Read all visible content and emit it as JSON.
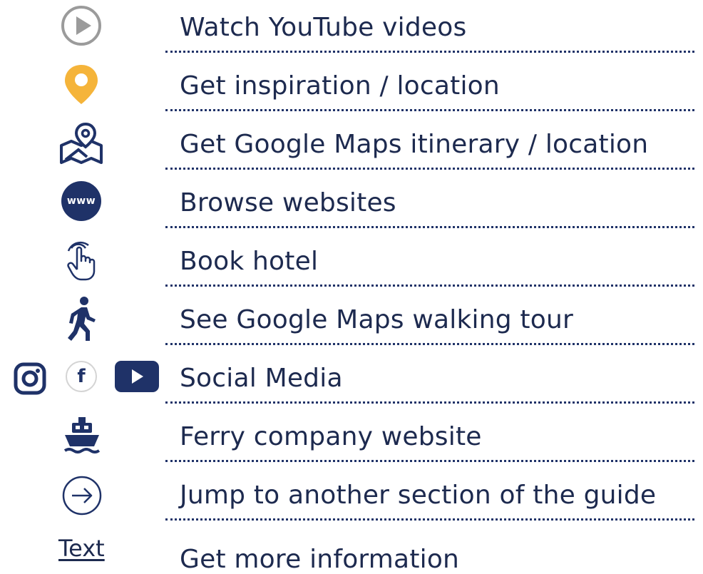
{
  "colors": {
    "navy": "#1f3268",
    "text": "#1d2a4f",
    "gray_icon": "#9b9b9b",
    "pin_yellow": "#f5b43a"
  },
  "legend": [
    {
      "icon": "play-circle-icon",
      "label": "Watch YouTube videos"
    },
    {
      "icon": "location-pin-icon",
      "label": "Get inspiration / location"
    },
    {
      "icon": "map-pin-icon",
      "label": "Get Google Maps itinerary / location"
    },
    {
      "icon": "www-icon",
      "icon_text": "www",
      "label": "Browse websites"
    },
    {
      "icon": "pointer-hand-icon",
      "label": "Book hotel"
    },
    {
      "icon": "walking-person-icon",
      "label": "See Google Maps walking tour"
    },
    {
      "icons": [
        "instagram-icon",
        "facebook-icon",
        "youtube-icon"
      ],
      "facebook_glyph": "f",
      "label": "Social Media"
    },
    {
      "icon": "ferry-icon",
      "label": "Ferry company website"
    },
    {
      "icon": "arrow-right-circle-icon",
      "label": "Jump to another section of the guide"
    },
    {
      "icon": "text-link-icon",
      "icon_text": "Text",
      "label": "Get more information"
    }
  ]
}
